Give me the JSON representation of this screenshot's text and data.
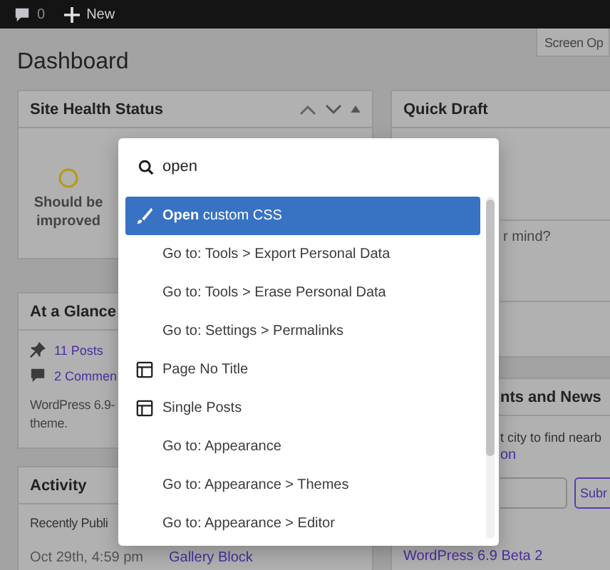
{
  "admin_bar": {
    "comments_count": "0",
    "new_label": "New"
  },
  "screen_options": "Screen Op",
  "page_title": "Dashboard",
  "site_health": {
    "title": "Site Health Status",
    "status": "Should be improved"
  },
  "at_a_glance": {
    "title": "At a Glance",
    "posts": "11 Posts",
    "comments": "2 Commen",
    "version_lines": [
      "WordPress 6.9-",
      "theme."
    ]
  },
  "activity": {
    "title": "Activity",
    "recently": "Recently Publi",
    "rows": [
      {
        "date": "Oct 29th, 4:59 pm",
        "title": "Gallery Block"
      }
    ]
  },
  "quick_draft": {
    "title": "Quick Draft",
    "content_fragment": "r mind?"
  },
  "events": {
    "title": "nts and News",
    "text": "t city to find nearb",
    "link": "on",
    "button": "Subr",
    "news": [
      "WordPress 6.9 Beta 2"
    ]
  },
  "command_palette": {
    "query": "open",
    "items": [
      {
        "kind": "command",
        "label": "**Open** custom CSS",
        "selected": true
      },
      {
        "kind": "link",
        "label": "Go to: Tools > Export Personal Data",
        "selected": false
      },
      {
        "kind": "link",
        "label": "Go to: Tools > Erase Personal Data",
        "selected": false
      },
      {
        "kind": "link",
        "label": "Go to: Settings > Permalinks",
        "selected": false
      },
      {
        "kind": "template",
        "label": "Page No Title",
        "selected": false
      },
      {
        "kind": "template",
        "label": "Single Posts",
        "selected": false
      },
      {
        "kind": "link",
        "label": "Go to: Appearance",
        "selected": false
      },
      {
        "kind": "link",
        "label": "Go to: Appearance > Themes",
        "selected": false
      },
      {
        "kind": "link",
        "label": "Go to: Appearance > Editor",
        "selected": false
      }
    ]
  }
}
